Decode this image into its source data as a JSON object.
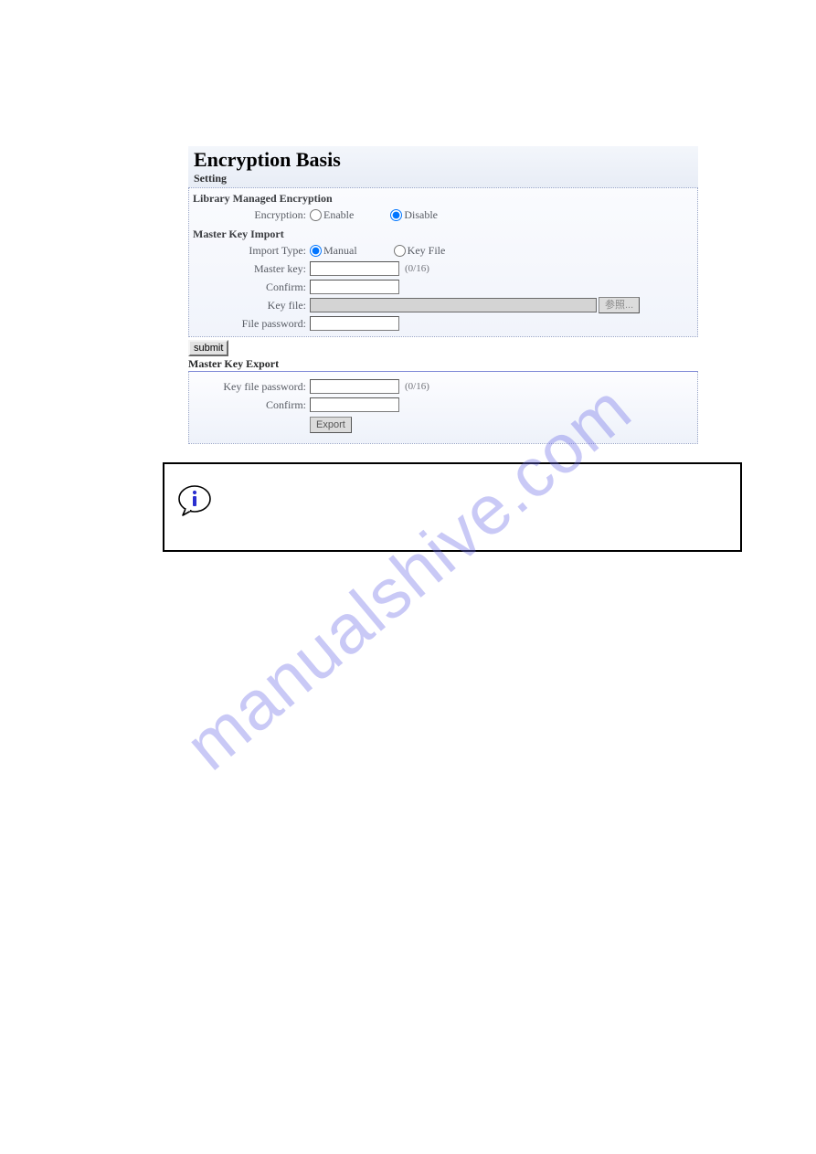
{
  "panel": {
    "title": "Encryption Basis",
    "subtitle": "Setting"
  },
  "library_managed": {
    "heading": "Library Managed Encryption",
    "encryption_label": "Encryption:",
    "opt_enable": "Enable",
    "opt_disable": "Disable",
    "encryption_value": "disable"
  },
  "master_key_import": {
    "heading": "Master Key Import",
    "import_type_label": "Import Type:",
    "opt_manual": "Manual",
    "opt_keyfile": "Key File",
    "import_type_value": "manual",
    "master_key_label": "Master key:",
    "master_key_value": "",
    "master_key_hint": "(0/16)",
    "confirm_label": "Confirm:",
    "confirm_value": "",
    "key_file_label": "Key file:",
    "key_file_value": "",
    "browse_label": "参照...",
    "file_password_label": "File password:",
    "file_password_value": ""
  },
  "submit_label": "submit",
  "master_key_export": {
    "heading": "Master Key Export",
    "key_file_password_label": "Key file password:",
    "key_file_password_value": "",
    "key_file_password_hint": "(0/16)",
    "confirm_label": "Confirm:",
    "confirm_value": "",
    "export_label": "Export"
  },
  "watermark": "manualshive.com"
}
